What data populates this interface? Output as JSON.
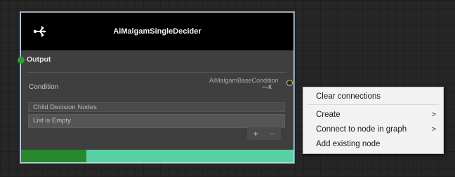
{
  "node": {
    "title": "AiMalgamSingleDecider",
    "icon": "decider-branch-icon",
    "output_label": "Output",
    "condition_label": "Condition",
    "condition_type": "AiMalgamBaseCondition",
    "condition_glyph": "—x",
    "list_header": "Child Decision Nodes",
    "list_empty_text": "List is Empty",
    "add_label": "+",
    "remove_label": "−",
    "progress_fraction": 0.24
  },
  "context_menu": {
    "items": [
      {
        "label": "Clear connections"
      },
      {
        "label": "Create",
        "submenu": true
      },
      {
        "label": "Connect to node in graph",
        "submenu": true
      },
      {
        "label": "Add existing node"
      }
    ],
    "submenu_glyph": ">"
  },
  "colors": {
    "output_port": "#2e9c3a",
    "condition_port_ring": "#d6ca6a",
    "bar_teal": "#58d0a4",
    "bar_green": "#27882e"
  }
}
